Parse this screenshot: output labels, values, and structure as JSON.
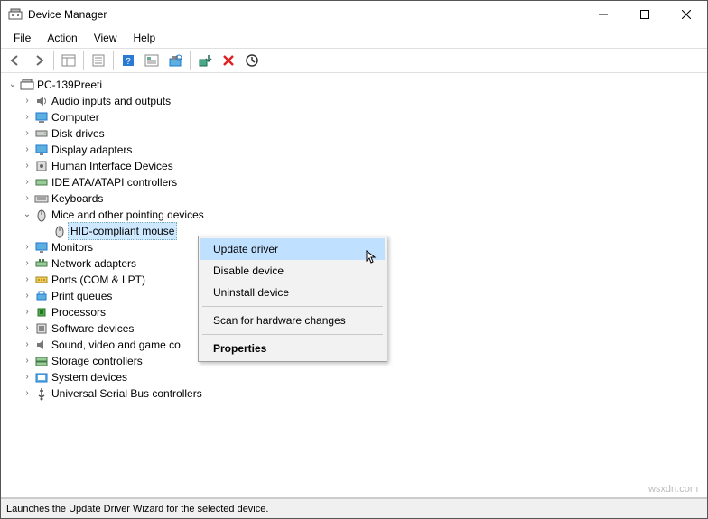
{
  "titlebar": {
    "title": "Device Manager"
  },
  "menubar": [
    "File",
    "Action",
    "View",
    "Help"
  ],
  "tree": {
    "root": "PC-139Preeti",
    "items": [
      {
        "label": "Audio inputs and outputs"
      },
      {
        "label": "Computer"
      },
      {
        "label": "Disk drives"
      },
      {
        "label": "Display adapters"
      },
      {
        "label": "Human Interface Devices"
      },
      {
        "label": "IDE ATA/ATAPI controllers"
      },
      {
        "label": "Keyboards"
      },
      {
        "label": "Mice and other pointing devices",
        "expanded": true,
        "child": "HID-compliant mouse"
      },
      {
        "label": "Monitors"
      },
      {
        "label": "Network adapters"
      },
      {
        "label": "Ports (COM & LPT)"
      },
      {
        "label": "Print queues"
      },
      {
        "label": "Processors"
      },
      {
        "label": "Software devices"
      },
      {
        "label": "Sound, video and game co"
      },
      {
        "label": "Storage controllers"
      },
      {
        "label": "System devices"
      },
      {
        "label": "Universal Serial Bus controllers"
      }
    ]
  },
  "context_menu": {
    "update": "Update driver",
    "disable": "Disable device",
    "uninstall": "Uninstall device",
    "scan": "Scan for hardware changes",
    "properties": "Properties"
  },
  "status": "Launches the Update Driver Wizard for the selected device.",
  "watermark": "wsxdn.com"
}
